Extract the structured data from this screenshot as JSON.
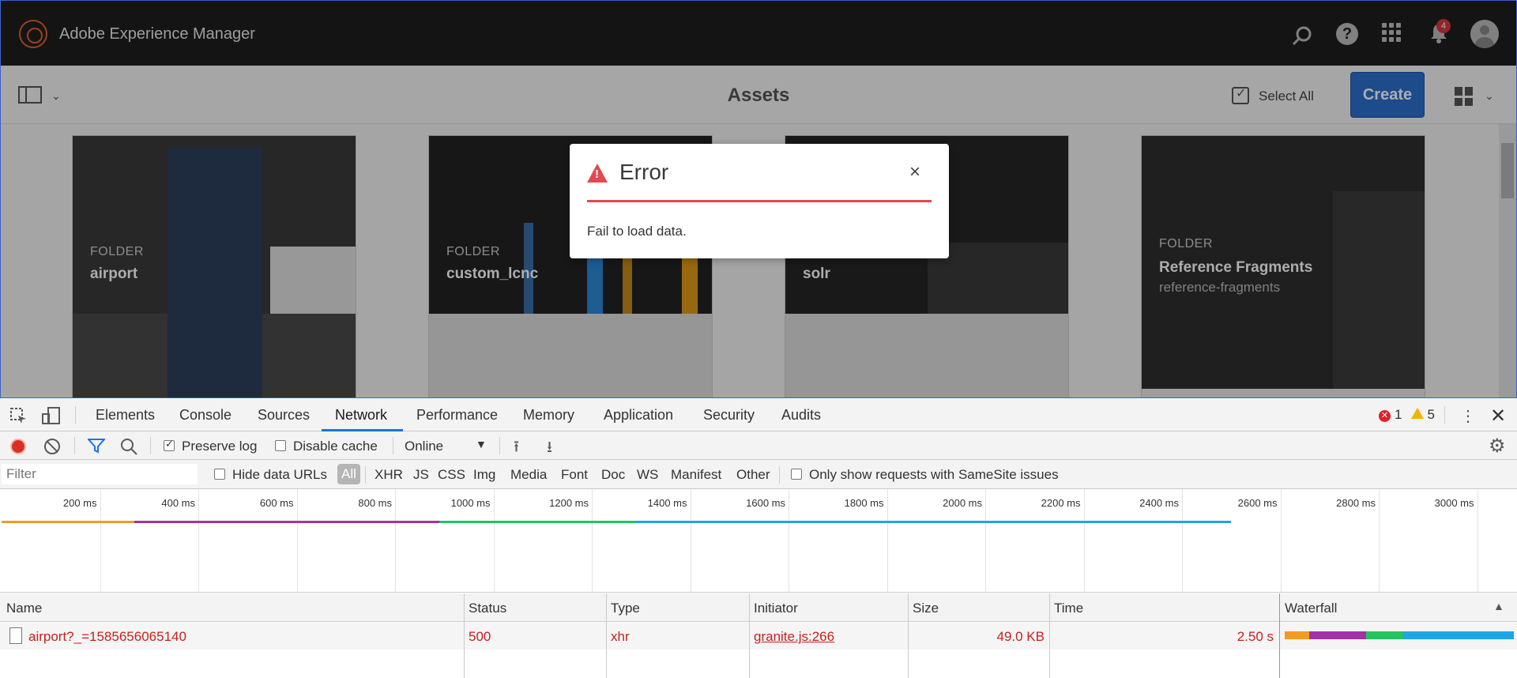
{
  "app": {
    "title": "Adobe Experience Manager",
    "notification_count": "4"
  },
  "actionbar": {
    "page_title": "Assets",
    "select_all_label": "Select All",
    "create_label": "Create"
  },
  "cards": [
    {
      "type": "FOLDER",
      "name": "airport",
      "sub": ""
    },
    {
      "type": "FOLDER",
      "name": "custom_lcnc",
      "sub": ""
    },
    {
      "type": "",
      "name": "solr",
      "sub": ""
    },
    {
      "type": "FOLDER",
      "name": "Reference Fragments",
      "sub": "reference-fragments"
    }
  ],
  "modal": {
    "title": "Error",
    "close_glyph": "×",
    "message": "Fail to load data."
  },
  "devtools": {
    "tabs": [
      "Elements",
      "Console",
      "Sources",
      "Network",
      "Performance",
      "Memory",
      "Application",
      "Security",
      "Audits"
    ],
    "active_tab": "Network",
    "error_count": "1",
    "warning_count": "5",
    "toolbar": {
      "preserve_log_label": "Preserve log",
      "preserve_log_checked": true,
      "disable_cache_label": "Disable cache",
      "disable_cache_checked": false,
      "throttling_value": "Online"
    },
    "filterbar": {
      "filter_placeholder": "Filter",
      "hide_data_urls_label": "Hide data URLs",
      "types": [
        "All",
        "XHR",
        "JS",
        "CSS",
        "Img",
        "Media",
        "Font",
        "Doc",
        "WS",
        "Manifest",
        "Other"
      ],
      "selected_type": "All",
      "samesite_label": "Only show requests with SameSite issues"
    },
    "overview": {
      "ticks": [
        "200 ms",
        "400 ms",
        "600 ms",
        "800 ms",
        "1000 ms",
        "1200 ms",
        "1400 ms",
        "1600 ms",
        "1800 ms",
        "2000 ms",
        "2200 ms",
        "2400 ms",
        "2600 ms",
        "2800 ms",
        "3000 ms"
      ],
      "timing_phases_ms": [
        {
          "phase": "queueing",
          "start": 0,
          "end": 270,
          "color": "#f29c1f"
        },
        {
          "phase": "waiting",
          "start": 270,
          "end": 890,
          "color": "#a232a6"
        },
        {
          "phase": "content",
          "start": 890,
          "end": 1290,
          "color": "#22c55e"
        },
        {
          "phase": "download",
          "start": 1290,
          "end": 2500,
          "color": "#1ba6e8"
        }
      ]
    },
    "columns": [
      "Name",
      "Status",
      "Type",
      "Initiator",
      "Size",
      "Time",
      "Waterfall"
    ],
    "rows": [
      {
        "name": "airport?_=1585656065140",
        "status": "500",
        "type": "xhr",
        "initiator": "granite.js:266",
        "size": "49.0 KB",
        "time": "2.50 s"
      }
    ]
  }
}
